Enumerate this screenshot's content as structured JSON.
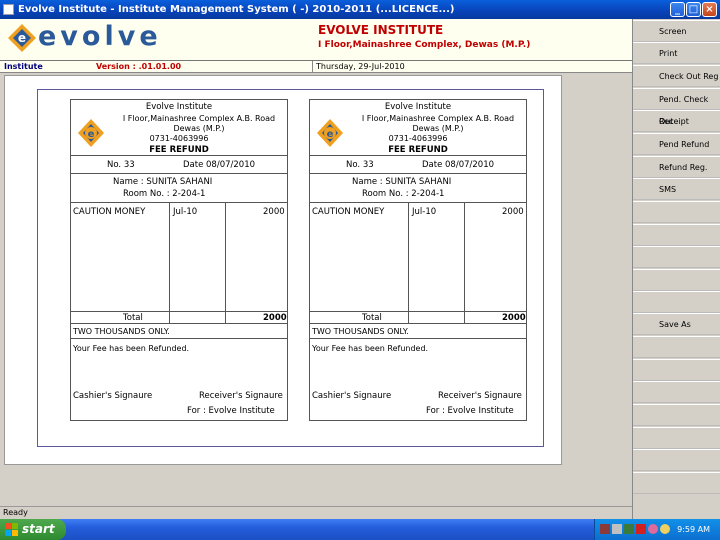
{
  "window": {
    "title": "Evolve Institute - Institute Management System ( -) 2010-2011 (...LICENCE...)"
  },
  "header": {
    "logo_text": "evolve",
    "institute_name": "EVOLVE INSTITUTE",
    "institute_address": "I Floor,Mainashree Complex, Dewas (M.P.)"
  },
  "infobar": {
    "section": "Institute",
    "version": "Version : .01.01.00",
    "date": "Thursday, 29-Jul-2010"
  },
  "sidebar": {
    "items": [
      "Screen",
      "Print",
      "Check Out Reg",
      "Pend. Check Out",
      "Receipt",
      "Pend Refund",
      "Refund Reg.",
      "SMS",
      "Save As"
    ]
  },
  "receipt": {
    "institute": "Evolve Institute",
    "address_line1": "I Floor,Mainashree Complex A.B. Road",
    "address_line2": "Dewas (M.P.)",
    "phone": "0731-4063996",
    "title": "FEE REFUND",
    "no": "No. 33",
    "date": "Date 08/07/2010",
    "name": "Name : SUNITA  SAHANI",
    "room": "Room No. : 2-204-1",
    "item_desc": "CAUTION MONEY",
    "item_month": "Jul-10",
    "item_amount": "2000",
    "total_label": "Total",
    "total_amount": "2000",
    "amount_words": "TWO THOUSANDS  ONLY.",
    "message": "Your Fee has been Refunded.",
    "cashier_sig": "Cashier's Signaure",
    "receiver_sig": "Receiver's Signaure",
    "for_line": "For  :  Evolve Institute"
  },
  "status": {
    "text": "Ready"
  },
  "taskbar": {
    "start_label": "start",
    "clock": "9:59 AM"
  },
  "colors": {
    "brand_red": "#c00000",
    "brand_blue": "#2b5a9a",
    "logo_orange": "#f0a020"
  }
}
